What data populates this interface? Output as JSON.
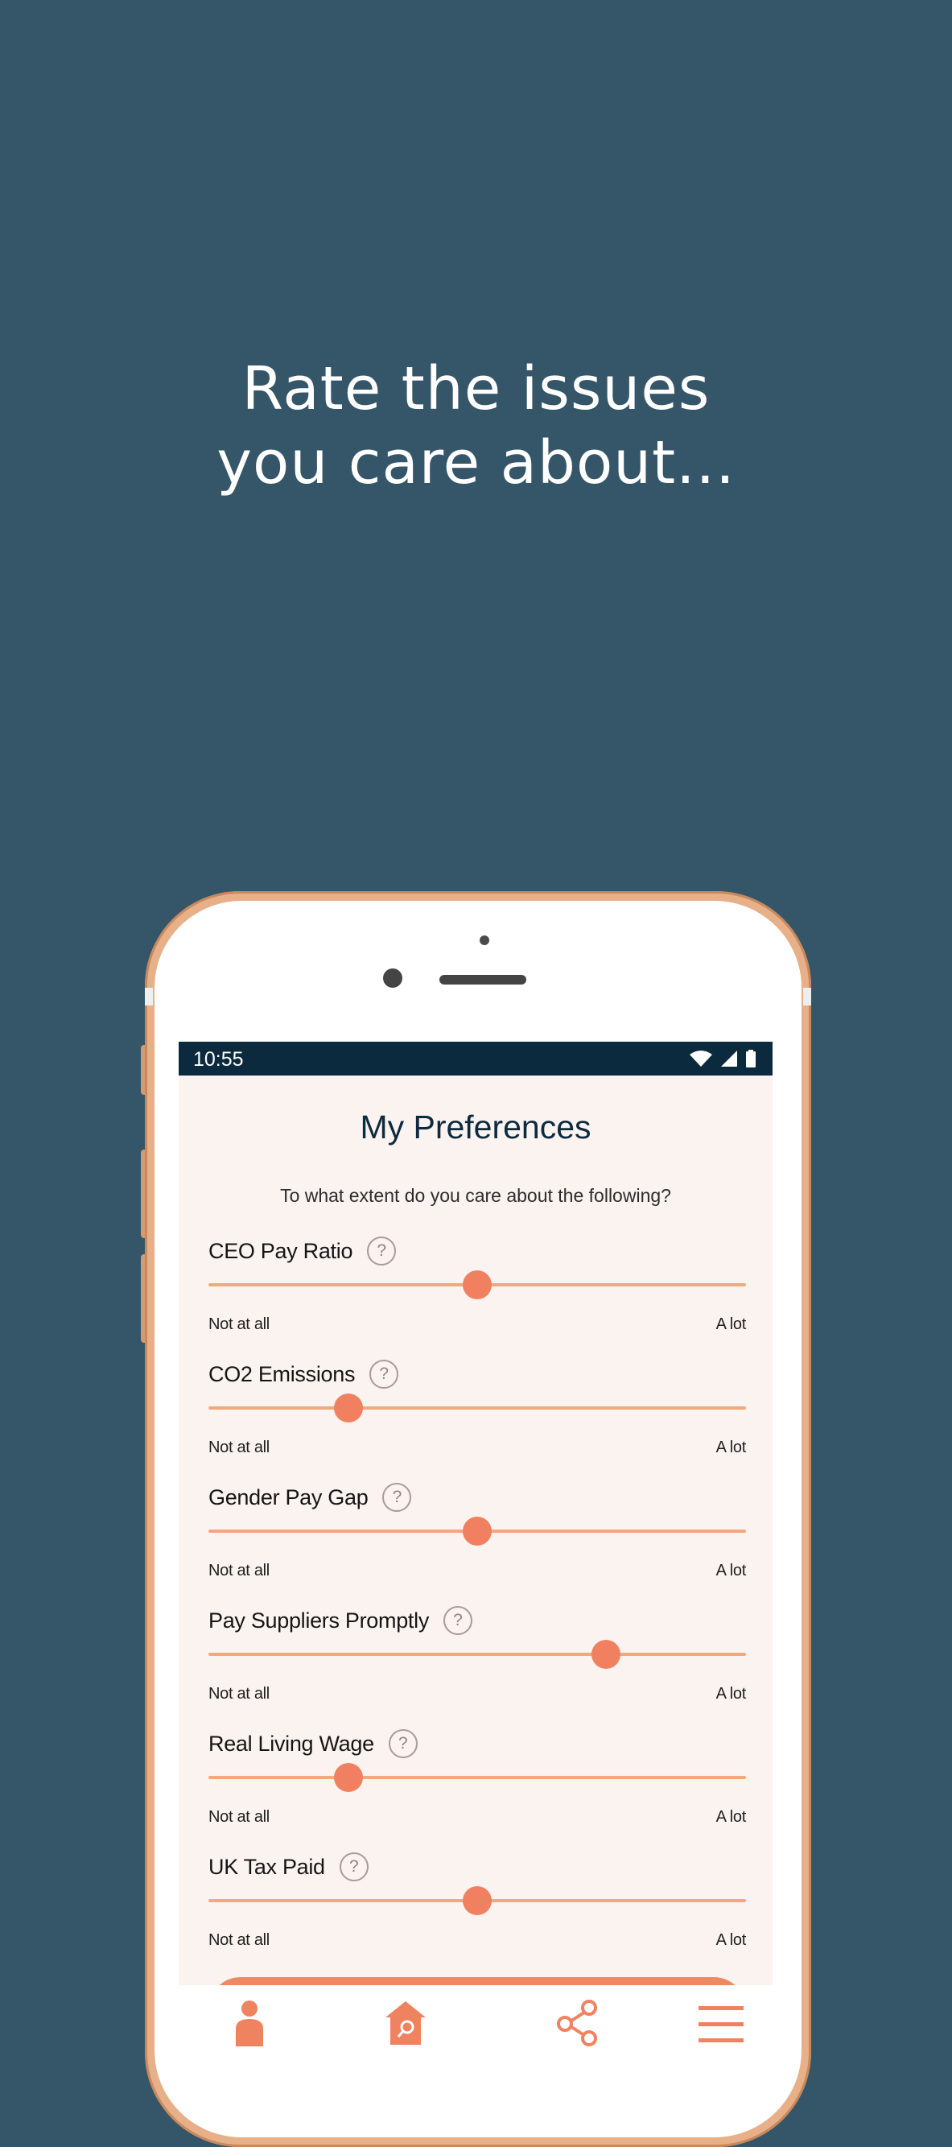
{
  "promo": {
    "headline_line1": "Rate the issues",
    "headline_line2": "you care about..."
  },
  "status_bar": {
    "time": "10:55",
    "icons": [
      "wifi-icon",
      "signal-icon",
      "battery-icon"
    ]
  },
  "screen": {
    "title": "My Preferences",
    "subtitle": "To what extent do you care about the following?",
    "help_glyph": "?",
    "scale_min_label": "Not at all",
    "scale_max_label": "A lot",
    "preferences": [
      {
        "label": "CEO Pay Ratio",
        "value": 0.5
      },
      {
        "label": "CO2 Emissions",
        "value": 0.26
      },
      {
        "label": "Gender Pay Gap",
        "value": 0.5
      },
      {
        "label": "Pay Suppliers Promptly",
        "value": 0.74
      },
      {
        "label": "Real Living Wage",
        "value": 0.26
      },
      {
        "label": "UK Tax Paid",
        "value": 0.5
      }
    ]
  },
  "bottom_nav": {
    "items": [
      {
        "icon": "person-icon"
      },
      {
        "icon": "home-search-icon"
      },
      {
        "icon": "share-icon"
      },
      {
        "icon": "menu-icon"
      }
    ]
  },
  "colors": {
    "background": "#355669",
    "accent": "#f0805f",
    "status_bar": "#0b2a3d",
    "screen_bg": "#fbf3ef",
    "phone_frame": "#e7b088"
  }
}
